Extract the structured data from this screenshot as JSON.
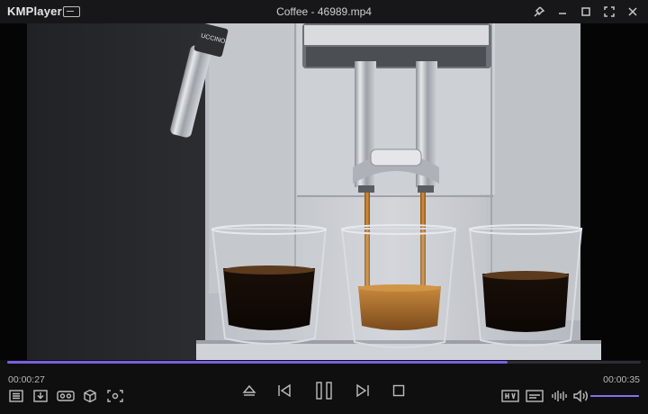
{
  "app": {
    "brand": "KMPlayer",
    "window_title": "Coffee - 46989.mp4"
  },
  "playback": {
    "elapsed": "00:00:27",
    "total": "00:00:35",
    "progress_fraction": 0.79,
    "state": "playing",
    "volume_fraction": 1.0
  },
  "colors": {
    "accent": "#7a5fe0",
    "titlebar_bg": "#17171a",
    "controls_bg": "#0f0f10"
  },
  "icons": {
    "title_bar": [
      "menu-icon",
      "pin-icon",
      "minimize-icon",
      "maximize-icon",
      "fullscreen-icon",
      "close-icon"
    ],
    "left_controls": [
      "playlist-icon",
      "download-icon",
      "vr-icon",
      "3d-cube-icon",
      "capture-icon"
    ],
    "center_controls": [
      "eject-icon",
      "previous-icon",
      "pause-icon",
      "next-icon",
      "stop-icon"
    ],
    "right_controls": [
      "subtitle-icon",
      "caption-icon",
      "equalizer-icon",
      "volume-icon"
    ]
  },
  "video": {
    "logo_text": "UCCINO"
  }
}
